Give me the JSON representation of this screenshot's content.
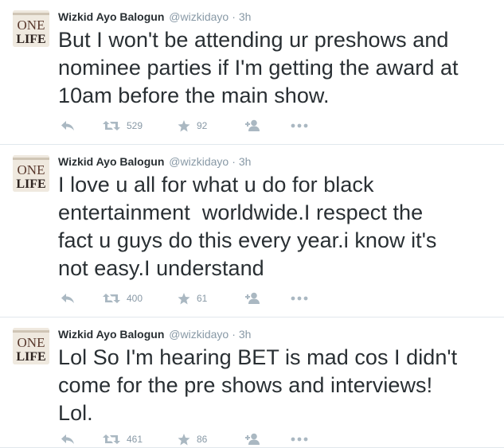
{
  "colors": {
    "text": "#292f33",
    "muted": "#8899a6",
    "icon": "#aab8c2",
    "divider": "#e1e8ed"
  },
  "avatar": {
    "text_top": "ONE",
    "text_bottom": "LIFE"
  },
  "tweets": [
    {
      "fullname": "Wizkid Ayo Balogun",
      "username": "@wizkidayo",
      "separator": "·",
      "time": "3h",
      "text": "But I won't be attending ur preshows and\nnominee parties if I'm getting the award at\n10am before the main show.",
      "retweets": "529",
      "favorites": "92"
    },
    {
      "fullname": "Wizkid Ayo Balogun",
      "username": "@wizkidayo",
      "separator": "·",
      "time": "3h",
      "text": "I love u all for what u do for black\nentertainment  worldwide.I respect the\nfact u guys do this every year.i know it's\nnot easy.I understand",
      "retweets": "400",
      "favorites": "61"
    },
    {
      "fullname": "Wizkid Ayo Balogun",
      "username": "@wizkidayo",
      "separator": "·",
      "time": "3h",
      "text": "Lol So I'm hearing BET is mad cos I didn't\ncome for the pre shows and interviews!\nLol.",
      "retweets": "461",
      "favorites": "86"
    }
  ]
}
